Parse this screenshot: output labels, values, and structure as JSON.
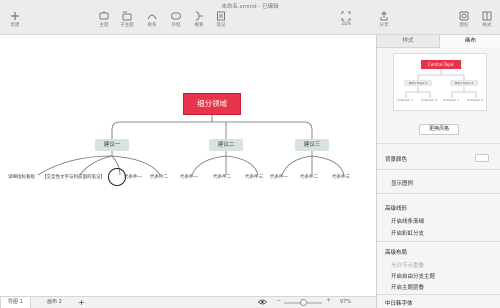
{
  "window": {
    "title": "未命名.xmind - 已编辑"
  },
  "toolbar": {
    "new": "新建",
    "topic": "主题",
    "subtopic": "子主题",
    "contact": "联系",
    "outline": "外框",
    "summary": "概要",
    "note": "笔记",
    "zen": "ZEN",
    "share": "分享",
    "icons": "图标",
    "format": "格式"
  },
  "map": {
    "central": "细分领域",
    "branches": [
      {
        "label": "建议一"
      },
      {
        "label": "建议二"
      },
      {
        "label": "建议三"
      }
    ],
    "leaves": [
      "详细指标看板",
      "【交互性文字与利前面的笔记】",
      "代条件一",
      "代条件二",
      "代条件一",
      "代条件二",
      "代条件三",
      "代条件一",
      "代条件二",
      "代条件三"
    ]
  },
  "status": {
    "sheet1": "导图 1",
    "sheet2": "画布 2",
    "add": "+",
    "zoom": "97%"
  },
  "panel": {
    "tab_style": "样式",
    "tab_canvas": "画布",
    "preview": {
      "central": "Central Topic",
      "main1": "Main Topic 1",
      "main2": "Main Topic 2",
      "sub1": "Subtopic 1",
      "sub2": "Subtopic 2",
      "sub3": "Subtopic 1",
      "sub4": "Subtopic 2"
    },
    "change_style": "更换风格",
    "bg_color": "背景颜色",
    "show_legend": "显示图例",
    "advanced_lines": "高级线形",
    "taper_lines": "开启线条渐细",
    "rainbow_branch": "开启彩虹分支",
    "advanced_layout": "高级布局",
    "topic_overlap": "允许节点重叠",
    "free_position": "开启自由分支主题",
    "level_layout": "开启主题层叠",
    "cjk_font": "中日韩字体"
  },
  "colors": {
    "central": "#e8344a",
    "branch": "#d8e2e0",
    "accent": "#e8344a"
  }
}
